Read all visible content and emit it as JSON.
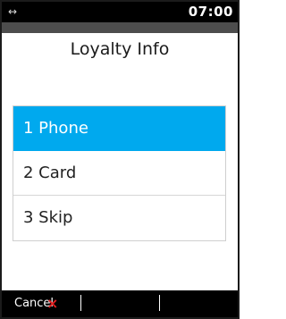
{
  "status_bar": {
    "link_icon": "↔",
    "time": "07:00"
  },
  "screen": {
    "title": "Loyalty Info"
  },
  "menu": {
    "items": [
      {
        "label": "1 Phone",
        "selected": true
      },
      {
        "label": "2 Card",
        "selected": false
      },
      {
        "label": "3 Skip",
        "selected": false
      }
    ]
  },
  "bottom_bar": {
    "cancel_label": "Cancel",
    "cancel_icon": "×"
  },
  "colors": {
    "selection": "#00a9ee",
    "cancel_icon": "#e02020",
    "bar": "#000000"
  }
}
